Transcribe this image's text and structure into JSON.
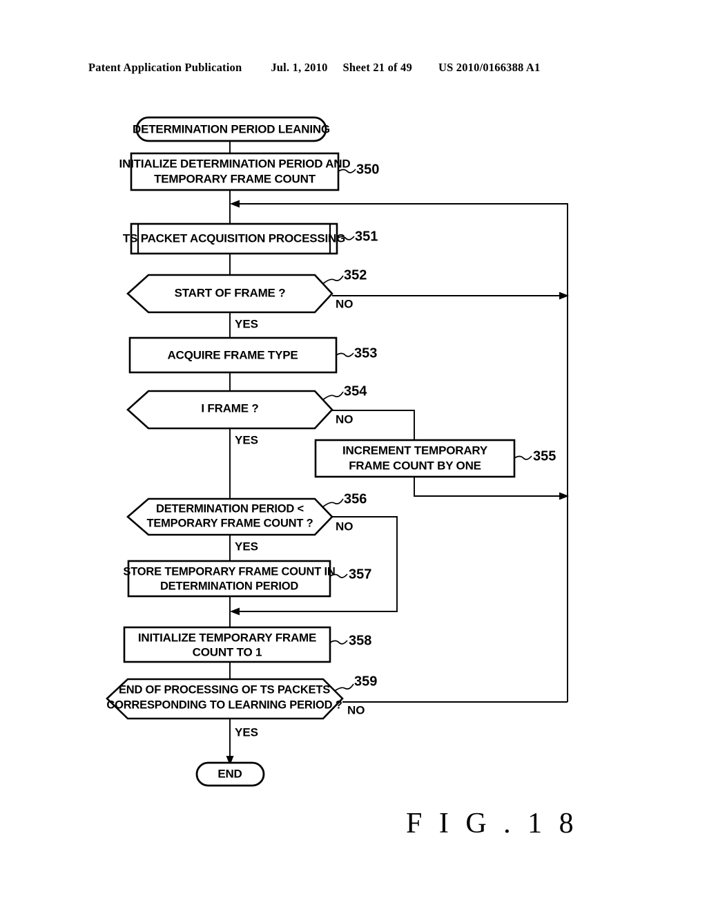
{
  "header": {
    "publication": "Patent Application Publication",
    "date": "Jul. 1, 2010",
    "sheet": "Sheet 21 of 49",
    "number": "US 2010/0166388 A1"
  },
  "figure": {
    "label": "F I G . 1 8"
  },
  "flowchart": {
    "start": {
      "label": "DETERMINATION PERIOD LEANING"
    },
    "end": {
      "label": "END"
    },
    "nodes": [
      {
        "ref": "350",
        "type": "process",
        "lines": [
          "INITIALIZE DETERMINATION PERIOD AND",
          "TEMPORARY FRAME COUNT"
        ]
      },
      {
        "ref": "351",
        "type": "predefined-process",
        "lines": [
          "TS PACKET ACQUISITION PROCESSING"
        ]
      },
      {
        "ref": "352",
        "type": "decision",
        "lines": [
          "START OF FRAME ?"
        ],
        "yes": "YES",
        "no": "NO"
      },
      {
        "ref": "353",
        "type": "process",
        "lines": [
          "ACQUIRE FRAME TYPE"
        ]
      },
      {
        "ref": "354",
        "type": "decision",
        "lines": [
          "I FRAME ?"
        ],
        "yes": "YES",
        "no": "NO"
      },
      {
        "ref": "355",
        "type": "process",
        "lines": [
          "INCREMENT TEMPORARY",
          "FRAME COUNT BY ONE"
        ]
      },
      {
        "ref": "356",
        "type": "decision",
        "lines": [
          "DETERMINATION PERIOD <",
          "TEMPORARY FRAME COUNT ?"
        ],
        "yes": "YES",
        "no": "NO"
      },
      {
        "ref": "357",
        "type": "process",
        "lines": [
          "STORE TEMPORARY FRAME COUNT IN",
          "DETERMINATION PERIOD"
        ]
      },
      {
        "ref": "358",
        "type": "process",
        "lines": [
          "INITIALIZE TEMPORARY FRAME",
          "COUNT TO 1"
        ]
      },
      {
        "ref": "359",
        "type": "decision",
        "lines": [
          "END OF PROCESSING OF TS PACKETS",
          "CORRESPONDING TO LEARNING PERIOD ?"
        ],
        "yes": "YES",
        "no": "NO"
      }
    ]
  },
  "colors": {
    "ink": "#000000",
    "paper": "#ffffff"
  }
}
